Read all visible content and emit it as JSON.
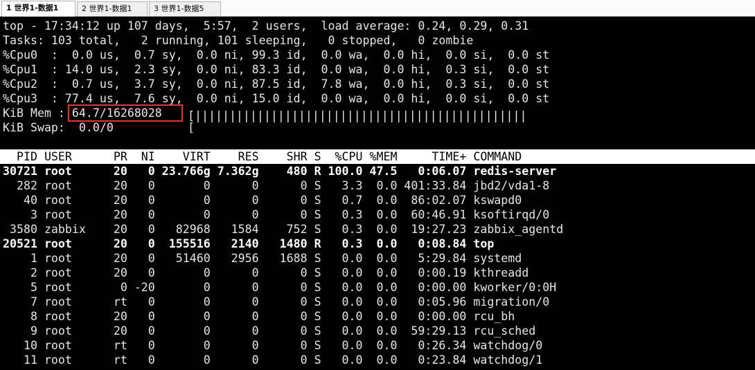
{
  "tabs": [
    {
      "label": "1 世界1-数据1"
    },
    {
      "label": "2 世界1-数据1"
    },
    {
      "label": "3 世界1-数据5"
    }
  ],
  "summary": {
    "top": "top - 17:34:12 up 107 days,  5:57,  2 users,  load average: 0.24, 0.29, 0.31",
    "tasks": "Tasks: 103 total,   2 running, 101 sleeping,   0 stopped,   0 zombie",
    "cpu0": "%Cpu0  :  0.0 us,  0.7 sy,  0.0 ni, 99.3 id,  0.0 wa,  0.0 hi,  0.0 si,  0.0 st",
    "cpu1": "%Cpu1  : 14.0 us,  2.3 sy,  0.0 ni, 83.3 id,  0.0 wa,  0.0 hi,  0.3 si,  0.0 st",
    "cpu2": "%Cpu2  :  0.7 us,  3.7 sy,  0.0 ni, 87.5 id,  7.8 wa,  0.0 hi,  0.3 si,  0.0 st",
    "cpu3": "%Cpu3  : 77.4 us,  7.6 sy,  0.0 ni, 15.0 id,  0.0 wa,  0.0 hi,  0.0 si,  0.0 st",
    "mem": "KiB Mem : 64.7/16268028",
    "mem_bar": "[||||||||||||||||||||||||||||||||||||||||||||||||",
    "swap": "KiB Swap:  0.0/0",
    "swap_bar": "["
  },
  "table_header": "  PID USER      PR  NI    VIRT    RES    SHR S  %CPU %MEM     TIME+ COMMAND",
  "processes": [
    {
      "line": "30721 root      20   0 23.766g 7.362g    480 R 100.0 47.5   0:06.07 redis-server"
    },
    {
      "line": "  282 root      20   0       0      0      0 S   3.3  0.0 401:33.84 jbd2/vda1-8"
    },
    {
      "line": "   40 root      20   0       0      0      0 S   0.7  0.0  86:02.07 kswapd0"
    },
    {
      "line": "    3 root      20   0       0      0      0 S   0.3  0.0  60:46.91 ksoftirqd/0"
    },
    {
      "line": " 3580 zabbix    20   0   82968   1584    752 S   0.3  0.0  19:27.23 zabbix_agentd"
    },
    {
      "line": "20521 root      20   0  155516   2140   1480 R   0.3  0.0   0:08.84 top"
    },
    {
      "line": "    1 root      20   0   51460   2956   1688 S   0.0  0.0   5:29.84 systemd"
    },
    {
      "line": "    2 root      20   0       0      0      0 S   0.0  0.0   0:00.19 kthreadd"
    },
    {
      "line": "    5 root       0 -20       0      0      0 S   0.0  0.0   0:00.00 kworker/0:0H"
    },
    {
      "line": "    7 root      rt   0       0      0      0 S   0.0  0.0   0:05.96 migration/0"
    },
    {
      "line": "    8 root      20   0       0      0      0 S   0.0  0.0   0:00.00 rcu_bh"
    },
    {
      "line": "    9 root      20   0       0      0      0 S   0.0  0.0  59:29.13 rcu_sched"
    },
    {
      "line": "   10 root      rt   0       0      0      0 S   0.0  0.0   0:26.34 watchdog/0"
    },
    {
      "line": "   11 root      rt   0       0      0      0 S   0.0  0.0   0:23.84 watchdog/1"
    }
  ]
}
